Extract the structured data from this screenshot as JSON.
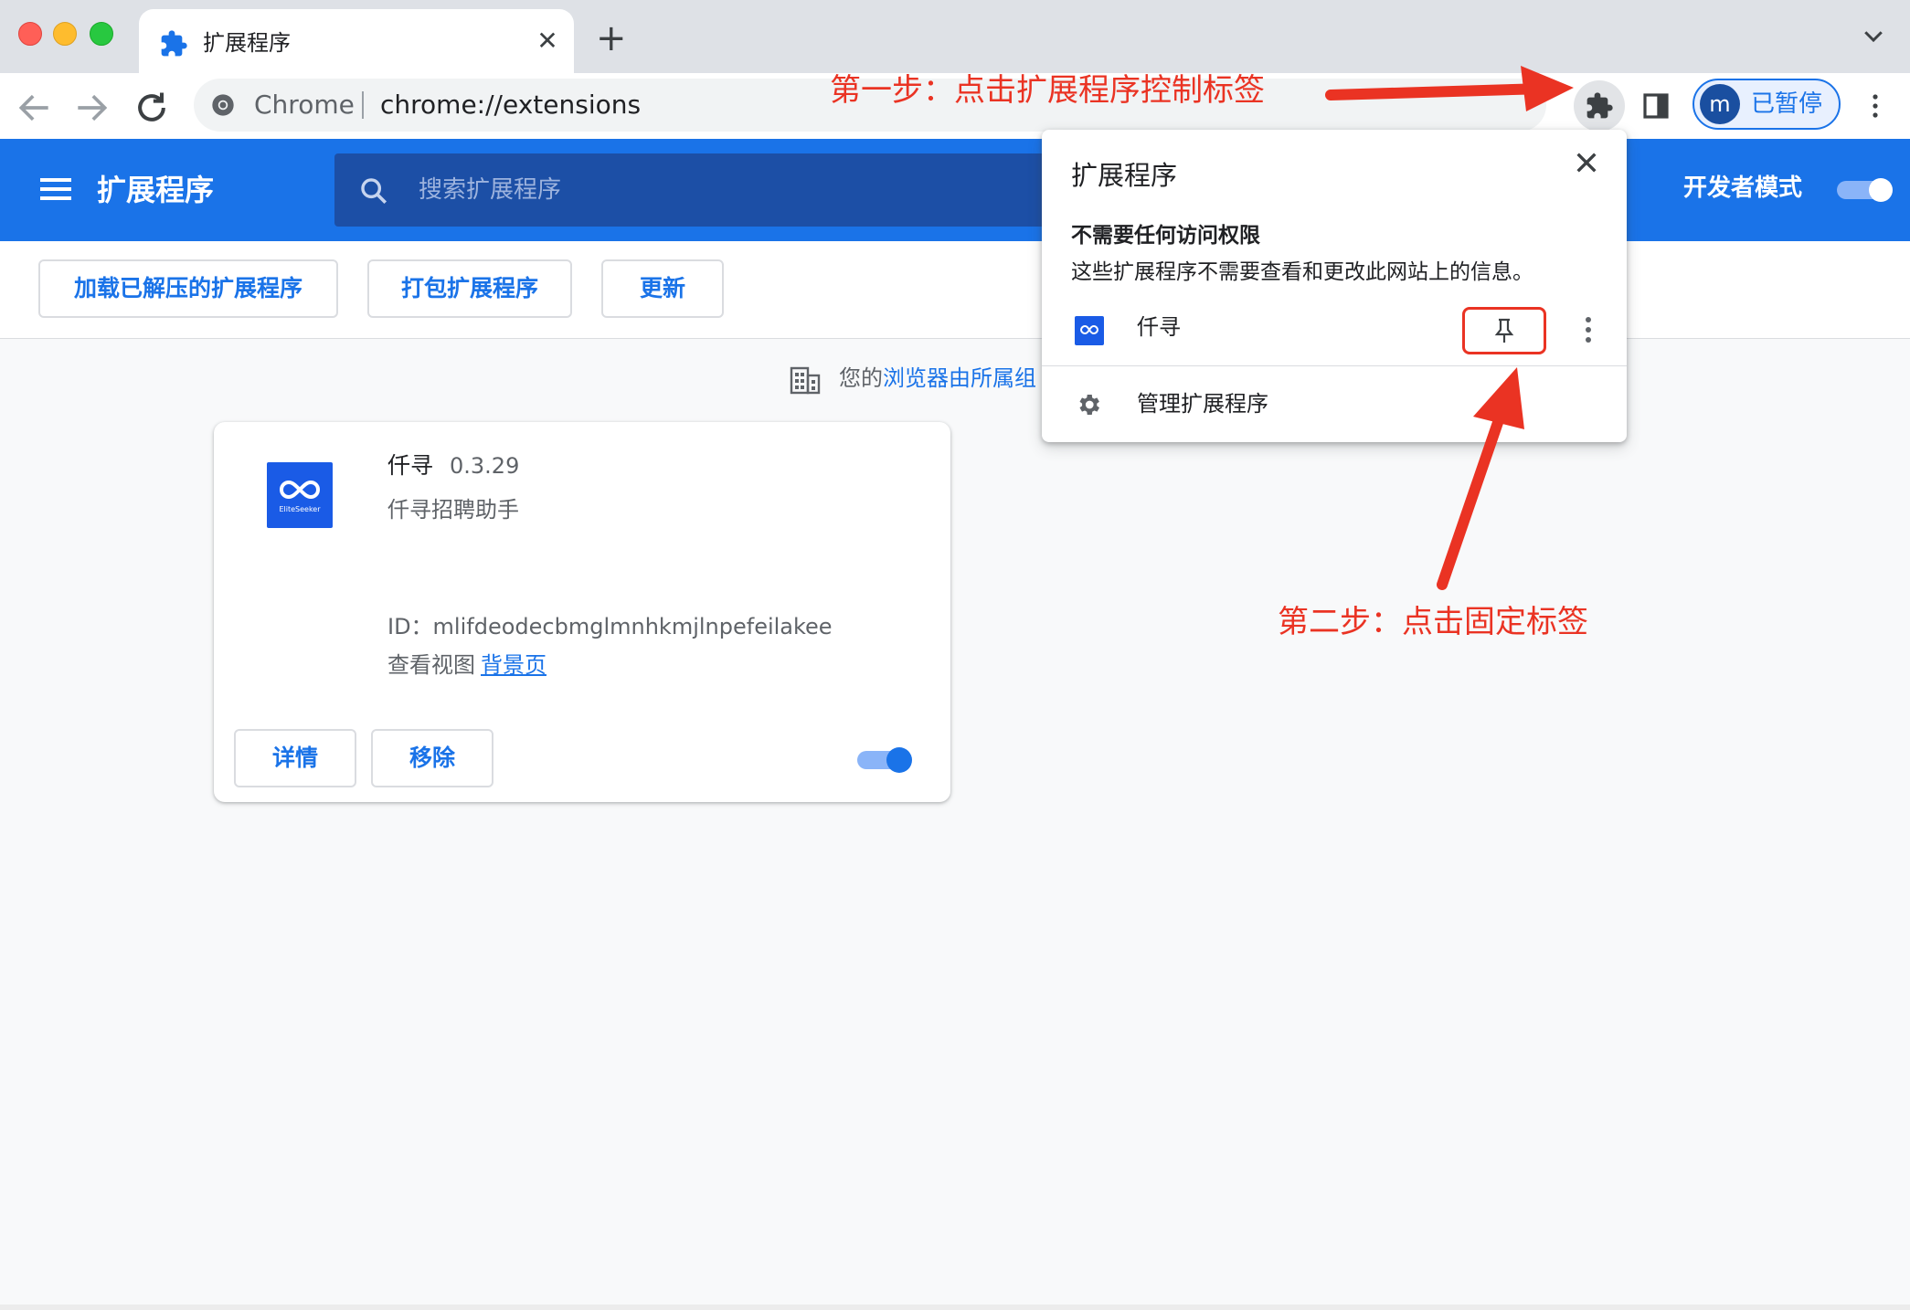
{
  "browser": {
    "tab": {
      "title": "扩展程序",
      "close": "✕"
    },
    "new_tab": "+",
    "omnibox": {
      "scheme_label": "Chrome",
      "url": "chrome://extensions"
    },
    "profile": {
      "initial": "m",
      "status": "已暂停"
    }
  },
  "header": {
    "title": "扩展程序",
    "search_placeholder": "搜索扩展程序",
    "dev_mode_label": "开发者模式",
    "dev_mode_on": true
  },
  "actions": {
    "load_unpacked": "加载已解压的扩展程序",
    "pack": "打包扩展程序",
    "update": "更新"
  },
  "managed_notice": {
    "prefix": "您的",
    "link": "浏览器由所属组"
  },
  "extension_card": {
    "name": "仟寻",
    "version": "0.3.29",
    "description": "仟寻招聘助手",
    "id_line": "ID：mlifdeodecbmglmnhkmjlnpefeilakee",
    "views_label": "查看视图",
    "views_link": "背景页",
    "details_button": "详情",
    "remove_button": "移除",
    "logo_text": "EliteSeeker",
    "enabled": true
  },
  "popup": {
    "title": "扩展程序",
    "section_title": "不需要任何访问权限",
    "section_desc": "这些扩展程序不需要查看和更改此网站上的信息。",
    "extension_name": "仟寻",
    "manage_label": "管理扩展程序"
  },
  "annotations": {
    "step1": "第一步：点击扩展程序控制标签",
    "step2": "第二步：点击固定标签",
    "color": "#ea3323"
  },
  "colors": {
    "accent": "#1a73e8",
    "header_bg": "#1a73e8",
    "logo_bg": "#1a5be6"
  }
}
